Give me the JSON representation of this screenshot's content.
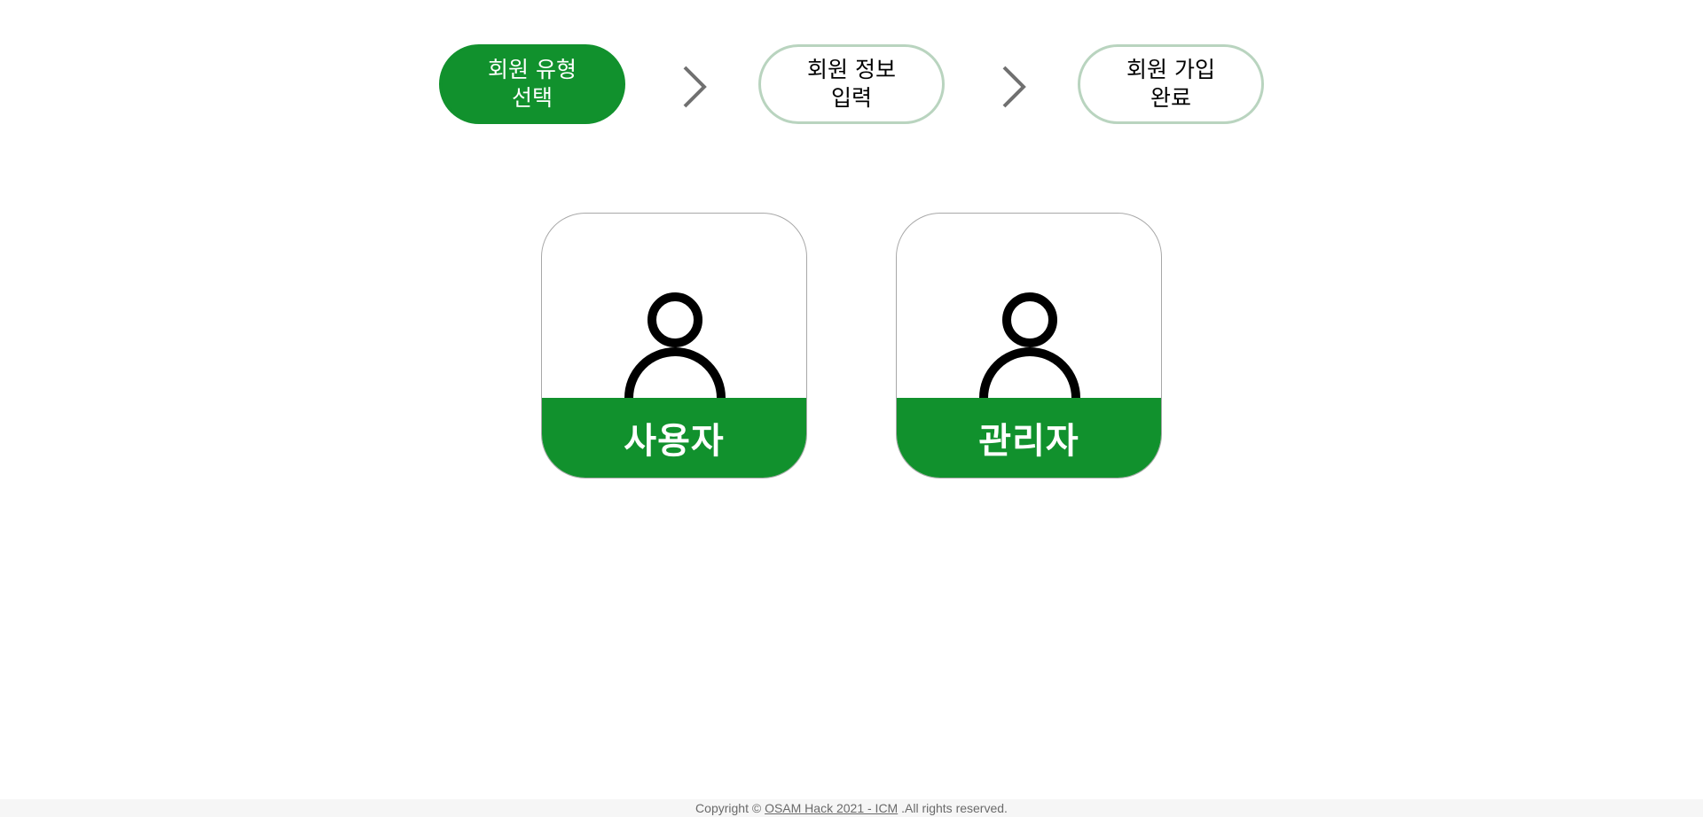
{
  "stepper": {
    "steps": [
      {
        "label": "회원 유형\n선택",
        "active": true
      },
      {
        "label": "회원 정보\n입력",
        "active": false
      },
      {
        "label": "회원 가입\n완료",
        "active": false
      }
    ]
  },
  "cards": {
    "user": {
      "label": "사용자",
      "icon": "person-icon"
    },
    "admin": {
      "label": "관리자",
      "icon": "person-icon"
    }
  },
  "footer": {
    "prefix": "Copyright © ",
    "link_text": "OSAM Hack 2021 - ICM",
    "suffix": " .All rights reserved."
  },
  "colors": {
    "brand_green": "#11912d",
    "inactive_border": "#b9d4bf",
    "chevron": "#707070",
    "card_border": "#a8a8a8",
    "footer_bg": "#f6f6f6"
  }
}
